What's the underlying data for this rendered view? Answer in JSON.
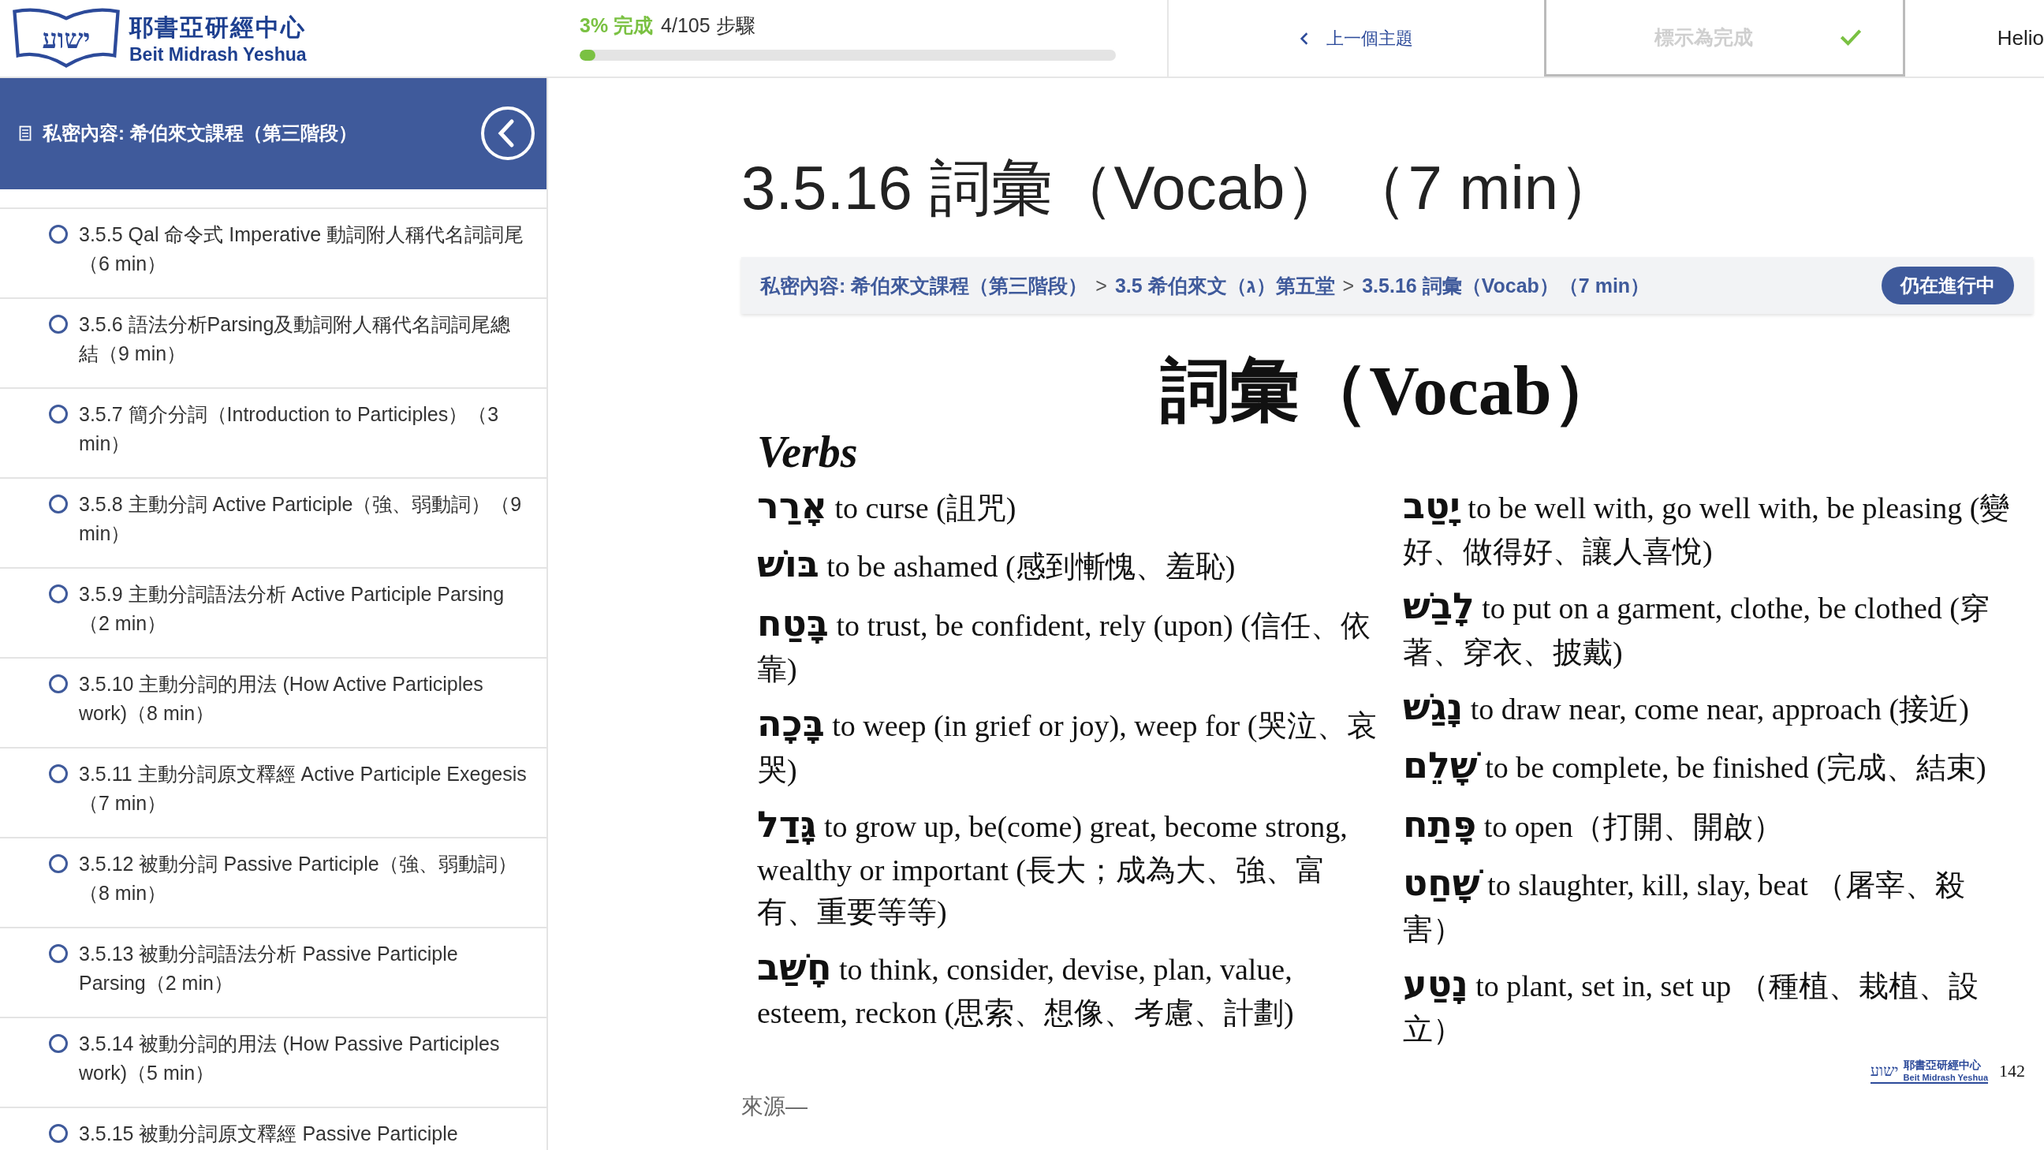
{
  "header": {
    "logo": {
      "hebrew": "ישוע",
      "name": "耶書亞研經中心",
      "subtitle": "Beit Midrash Yeshua"
    },
    "progress": {
      "percent": "3% 完成",
      "steps": "4/105 步驟",
      "level": 0.03
    },
    "prev_button": "上一個主題",
    "complete_button": {
      "label": "標示為完成",
      "disabled": true
    },
    "user": "Helio"
  },
  "sidebar": {
    "title": "私密內容: 希伯來文課程（第三階段）",
    "items": [
      {
        "label": "3.5.5 Qal 命令式 Imperative 動詞附人稱代名詞詞尾（6 min）",
        "completed": false
      },
      {
        "label": "3.5.6 語法分析Parsing及動詞附人稱代名詞詞尾總結（9 min）",
        "completed": false
      },
      {
        "label": "3.5.7 簡介分詞（Introduction to Participles）（3 min）",
        "completed": false
      },
      {
        "label": "3.5.8 主動分詞 Active Participle（強、弱動詞）（9 min）",
        "completed": false
      },
      {
        "label": "3.5.9 主動分詞語法分析 Active Participle Parsing（2 min）",
        "completed": false
      },
      {
        "label": "3.5.10 主動分詞的用法 (How Active Participles work)（8 min）",
        "completed": false
      },
      {
        "label": "3.5.11 主動分詞原文釋經 Active Participle Exegesis（7 min）",
        "completed": false
      },
      {
        "label": "3.5.12 被動分詞 Passive Participle（強、弱動詞）（8 min）",
        "completed": false
      },
      {
        "label": "3.5.13 被動分詞語法分析 Passive Participle Parsing（2 min）",
        "completed": false
      },
      {
        "label": "3.5.14 被動分詞的用法 (How Passive Participles work)（5 min）",
        "completed": false
      },
      {
        "label": "3.5.15 被動分詞原文釋經 Passive Participle",
        "completed": false
      }
    ]
  },
  "lesson": {
    "title": "3.5.16 詞彙（Vocab）（7 min）",
    "breadcrumb": {
      "separator": ">",
      "items": [
        "私密內容: 希伯來文課程（第三階段）",
        "3.5 希伯來文（ג）第五堂",
        "3.5.16 詞彙（Vocab）（7 min）"
      ]
    },
    "status": "仍在進行中",
    "slide": {
      "title": "詞彙（Vocab）",
      "section": "Verbs",
      "left_entries": [
        {
          "hebrew": "אָרַר",
          "gloss": "to curse (詛咒)"
        },
        {
          "hebrew": "בּוֹשׁ",
          "gloss": "to be ashamed (感到慚愧、羞恥)"
        },
        {
          "hebrew": "בָּטַח",
          "gloss": "to trust, be confident, rely (upon) (信任、依靠)"
        },
        {
          "hebrew": "בָּכָה",
          "gloss": "to weep (in grief or joy), weep for (哭泣、哀哭)"
        },
        {
          "hebrew": "גָּדַל",
          "gloss": "to grow up, be(come) great, become strong, wealthy or important (長大；成為大、強、富有、重要等等)"
        },
        {
          "hebrew": "חָשַׁב",
          "gloss": "to think, consider, devise, plan, value, esteem, reckon (思索、想像、考慮、計劃)"
        }
      ],
      "right_entries": [
        {
          "hebrew": "יָטַב",
          "gloss": "to be well with, go well with, be pleasing (變好、做得好、讓人喜悅)"
        },
        {
          "hebrew": "לָבַשׁ",
          "gloss": "to put on a garment, clothe, be clothed (穿著、穿衣、披戴)"
        },
        {
          "hebrew": "נָגַשׁ",
          "gloss": "to draw near, come near, approach (接近)"
        },
        {
          "hebrew": "שָׁלֵם",
          "gloss": "to be complete, be finished (完成、結束)"
        },
        {
          "hebrew": "פָּתַח",
          "gloss": "to open（打開、開啟）"
        },
        {
          "hebrew": "שָׁחַט",
          "gloss": "to slaughter, kill, slay, beat （屠宰、殺害）"
        },
        {
          "hebrew": "נָטַע",
          "gloss": "to plant, set in, set up （種植、栽植、設立）"
        }
      ],
      "footer": {
        "hebrew": "ישוע",
        "name": "耶書亞研經中心",
        "subtitle": "Beit Midrash Yeshua",
        "page": "142"
      }
    },
    "source": "來源—"
  }
}
